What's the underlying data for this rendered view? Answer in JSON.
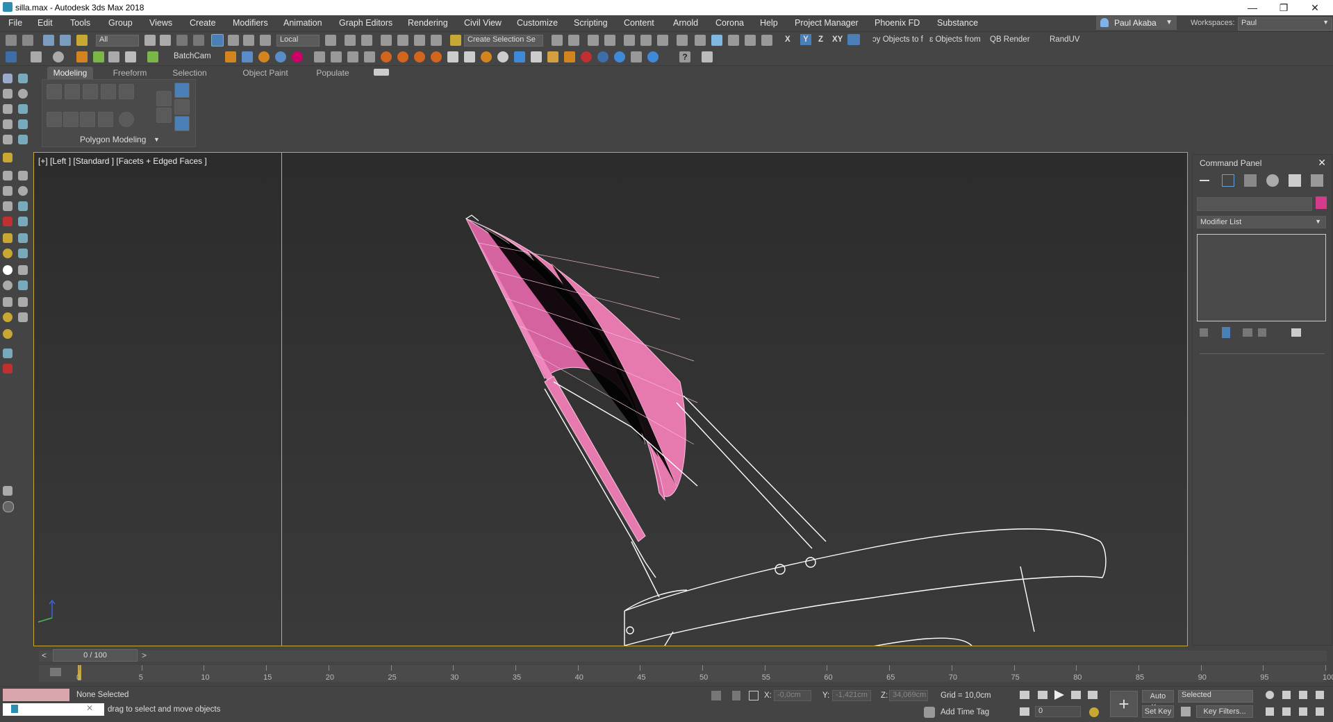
{
  "title_bar": {
    "title": "silla.max - Autodesk 3ds Max 2018",
    "minimize": "—",
    "restore": "❐",
    "close": "✕"
  },
  "menu": [
    "File",
    "Edit",
    "Tools",
    "Group",
    "Views",
    "Create",
    "Modifiers",
    "Animation",
    "Graph Editors",
    "Rendering",
    "Civil View",
    "Customize",
    "Scripting",
    "Content",
    "Arnold",
    "Corona",
    "Help",
    "Project Manager",
    "Phoenix FD",
    "Substance"
  ],
  "user": {
    "name": "Paul Akaba"
  },
  "workspace": {
    "label": "Workspaces:",
    "value": "Paul"
  },
  "toolbar": {
    "selection_filter": "All",
    "ref_coord": "Local",
    "named_selection": "Create Selection Se",
    "axis_x": "X",
    "axis_y": "Y",
    "axis_z": "Z",
    "axis_xy": "XY",
    "btn_objects_to": "ɔy Objects to f",
    "btn_objects_from": "ɛ Objects from",
    "btn_qb_render": "QB Render",
    "btn_randuv": "RandUV",
    "batchcam": "BatchCam"
  },
  "ribbon": {
    "tabs": [
      "Modeling",
      "Freeform",
      "Selection",
      "Object Paint",
      "Populate"
    ],
    "active_tab": "Modeling",
    "panel_label": "Polygon Modeling"
  },
  "viewport": {
    "label": "[+] [Left ] [Standard ] [Facets + Edged Faces ]"
  },
  "command_panel": {
    "title": "Command Panel",
    "modifier_list": "Modifier List",
    "object_color": "#d63a8a"
  },
  "timeline": {
    "frame_display": "0 / 100",
    "ticks": [
      "0",
      "5",
      "10",
      "15",
      "20",
      "25",
      "30",
      "35",
      "40",
      "45",
      "50",
      "55",
      "60",
      "65",
      "70",
      "75",
      "80",
      "85",
      "90",
      "95",
      "100"
    ]
  },
  "status": {
    "selection": "None Selected",
    "prompt": "drag to select and move objects",
    "x_label": "X:",
    "x_value": "-0,0cm",
    "y_label": "Y:",
    "y_value": "-1,421cm",
    "z_label": "Z:",
    "z_value": "34,069cm",
    "grid": "Grid = 10,0cm",
    "add_time_tag": "Add Time Tag",
    "auto_key": "Auto Key",
    "set_key": "Set Key",
    "key_mode": "Selected",
    "key_filters": "Key Filters...",
    "current_frame": "0"
  },
  "colors": {
    "accent_yellow": "#c8a832",
    "pink_mesh": "#e679ad",
    "wire": "#ffffff"
  }
}
